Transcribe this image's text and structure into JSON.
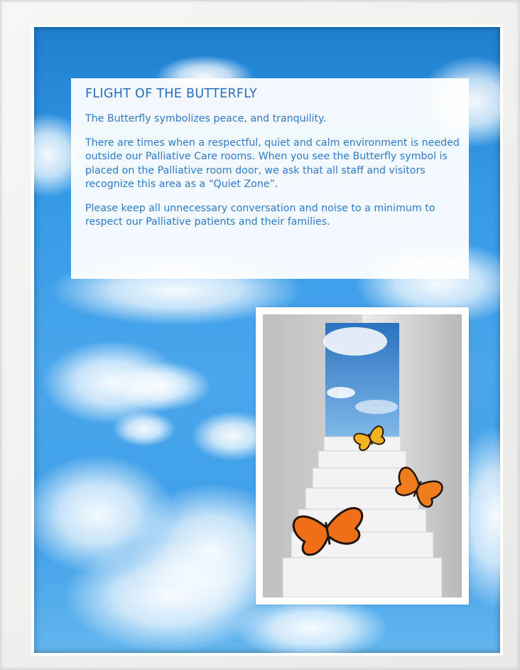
{
  "poster": {
    "title": "FLIGHT OF THE BUTTERFLY",
    "paragraphs": [
      "The Butterfly symbolizes peace, and tranquility.",
      "There are times when a respectful, quiet and calm environment is needed outside our Palliative Care rooms.  When you see the Butterfly symbol is placed on the Palliative room door, we ask that all staff and visitors recognize this area as a “Quiet Zone”.",
      "Please keep all unnecessary conversation and noise to a minimum to respect our Palliative patients and their families."
    ],
    "image_subject": "staircase to sky with monarch butterflies"
  },
  "colors": {
    "text": "#2c7ac9",
    "sky": "#3399e6",
    "frame": "#f4f4f2"
  }
}
